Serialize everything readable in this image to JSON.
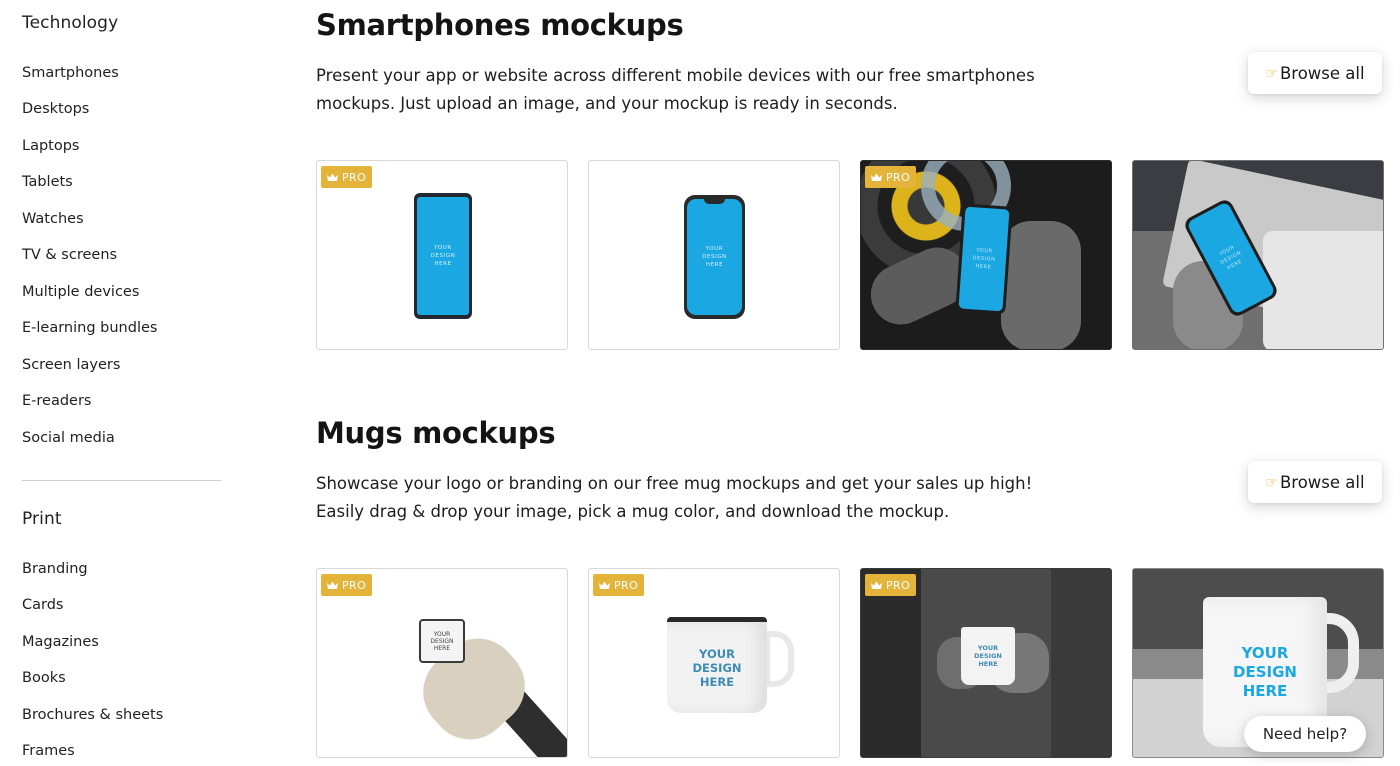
{
  "sidebar": {
    "technology": {
      "heading": "Technology",
      "items": [
        "Smartphones",
        "Desktops",
        "Laptops",
        "Tablets",
        "Watches",
        "TV & screens",
        "Multiple devices",
        "E-learning bundles",
        "Screen layers",
        "E-readers",
        "Social media"
      ]
    },
    "print": {
      "heading": "Print",
      "items": [
        "Branding",
        "Cards",
        "Magazines",
        "Books",
        "Brochures & sheets",
        "Frames"
      ]
    }
  },
  "sections": [
    {
      "title": "Smartphones mockups",
      "description": "Present your app or website across different mobile devices with our free smartphones mockups. Just upload an image, and your mockup is ready in seconds.",
      "browse_label": "Browse all",
      "cards": [
        {
          "pro": true,
          "pro_label": "PRO",
          "screen_text": "YOUR DESIGN HERE"
        },
        {
          "pro": false,
          "screen_text": "YOUR DESIGN HERE"
        },
        {
          "pro": true,
          "pro_label": "PRO",
          "screen_text": "YOUR DESIGN HERE"
        },
        {
          "pro": false,
          "screen_text": "YOUR DESIGN HERE"
        }
      ]
    },
    {
      "title": "Mugs mockups",
      "description": "Showcase your logo or branding on our free mug mockups and get your sales up high! Easily drag & drop your image, pick a mug color, and download the mockup.",
      "browse_label": "Browse all",
      "cards": [
        {
          "pro": true,
          "pro_label": "PRO",
          "mug_text": "YOUR DESIGN HERE"
        },
        {
          "pro": true,
          "pro_label": "PRO",
          "mug_text": "YOUR DESIGN HERE"
        },
        {
          "pro": true,
          "pro_label": "PRO",
          "mug_text": "YOUR DESIGN HERE"
        },
        {
          "pro": false,
          "mug_text": "YOUR DESIGN HERE"
        }
      ]
    }
  ],
  "help_button": "Need help?",
  "colors": {
    "pro_badge": "#e4b43a",
    "screen_blue": "#1ba7e1",
    "hand_icon": "#e8b21e"
  },
  "icons": {
    "pro_badge": "crown-icon",
    "browse_button": "pointing-hand-icon"
  }
}
